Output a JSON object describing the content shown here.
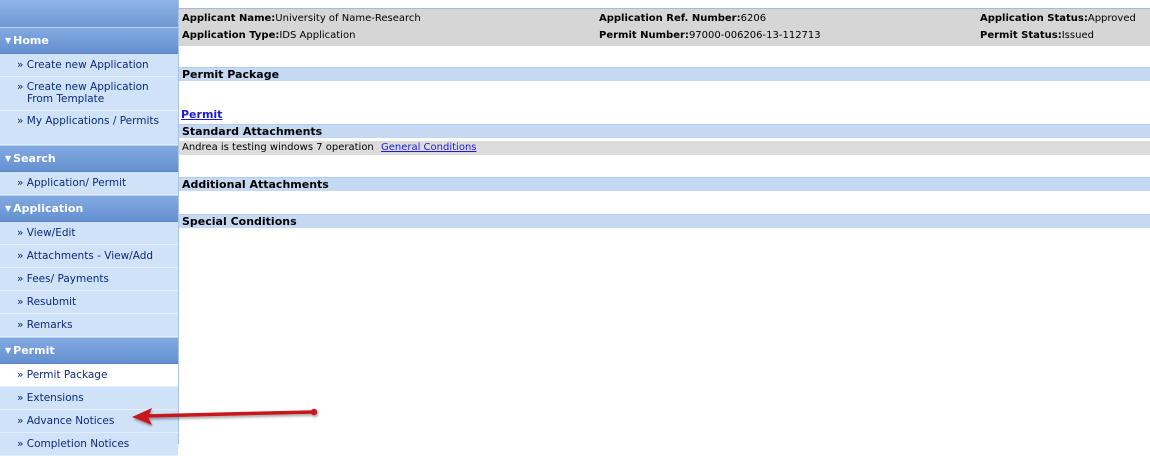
{
  "sidebar": {
    "sections": [
      {
        "title": "Home",
        "items": [
          {
            "label": "» Create new Application"
          },
          {
            "label": "» Create new Application From Template"
          },
          {
            "label": "» My Applications / Permits"
          }
        ]
      },
      {
        "title": "Search",
        "items": [
          {
            "label": "» Application/ Permit"
          }
        ]
      },
      {
        "title": "Application",
        "items": [
          {
            "label": "» View/Edit"
          },
          {
            "label": "» Attachments - View/Add"
          },
          {
            "label": "» Fees/ Payments"
          },
          {
            "label": "» Resubmit"
          },
          {
            "label": "» Remarks"
          }
        ]
      },
      {
        "title": "Permit",
        "items": [
          {
            "label": "» Permit Package"
          },
          {
            "label": "» Extensions"
          },
          {
            "label": "» Advance Notices"
          },
          {
            "label": "» Completion Notices"
          }
        ]
      }
    ]
  },
  "header": {
    "applicant_name_label": "Applicant Name:",
    "applicant_name": "University of Name-Research",
    "application_type_label": "Application Type:",
    "application_type": "IDS Application",
    "ref_number_label": "Application Ref. Number:",
    "ref_number": "6206",
    "permit_number_label": "Permit Number:",
    "permit_number": "97000-006206-13-112713",
    "app_status_label": "Application Status:",
    "app_status": "Approved",
    "permit_status_label": "Permit Status:",
    "permit_status": "Issued"
  },
  "main": {
    "permit_package_title": "Permit Package",
    "permit_link": "Permit",
    "standard_attachments_title": "Standard Attachments",
    "standard_attachment_text": "Andrea is testing windows 7 operation",
    "standard_attachment_link": "General Conditions",
    "additional_attachments_title": "Additional Attachments",
    "special_conditions_title": "Special Conditions"
  },
  "colors": {
    "sidebar_bg": "#cfe2f8",
    "section_header": "#6f99d4",
    "header_bg": "#d6d6d6",
    "section_bar": "#c6d9f3",
    "link": "#1b1bd9",
    "arrow": "#c8161d"
  }
}
